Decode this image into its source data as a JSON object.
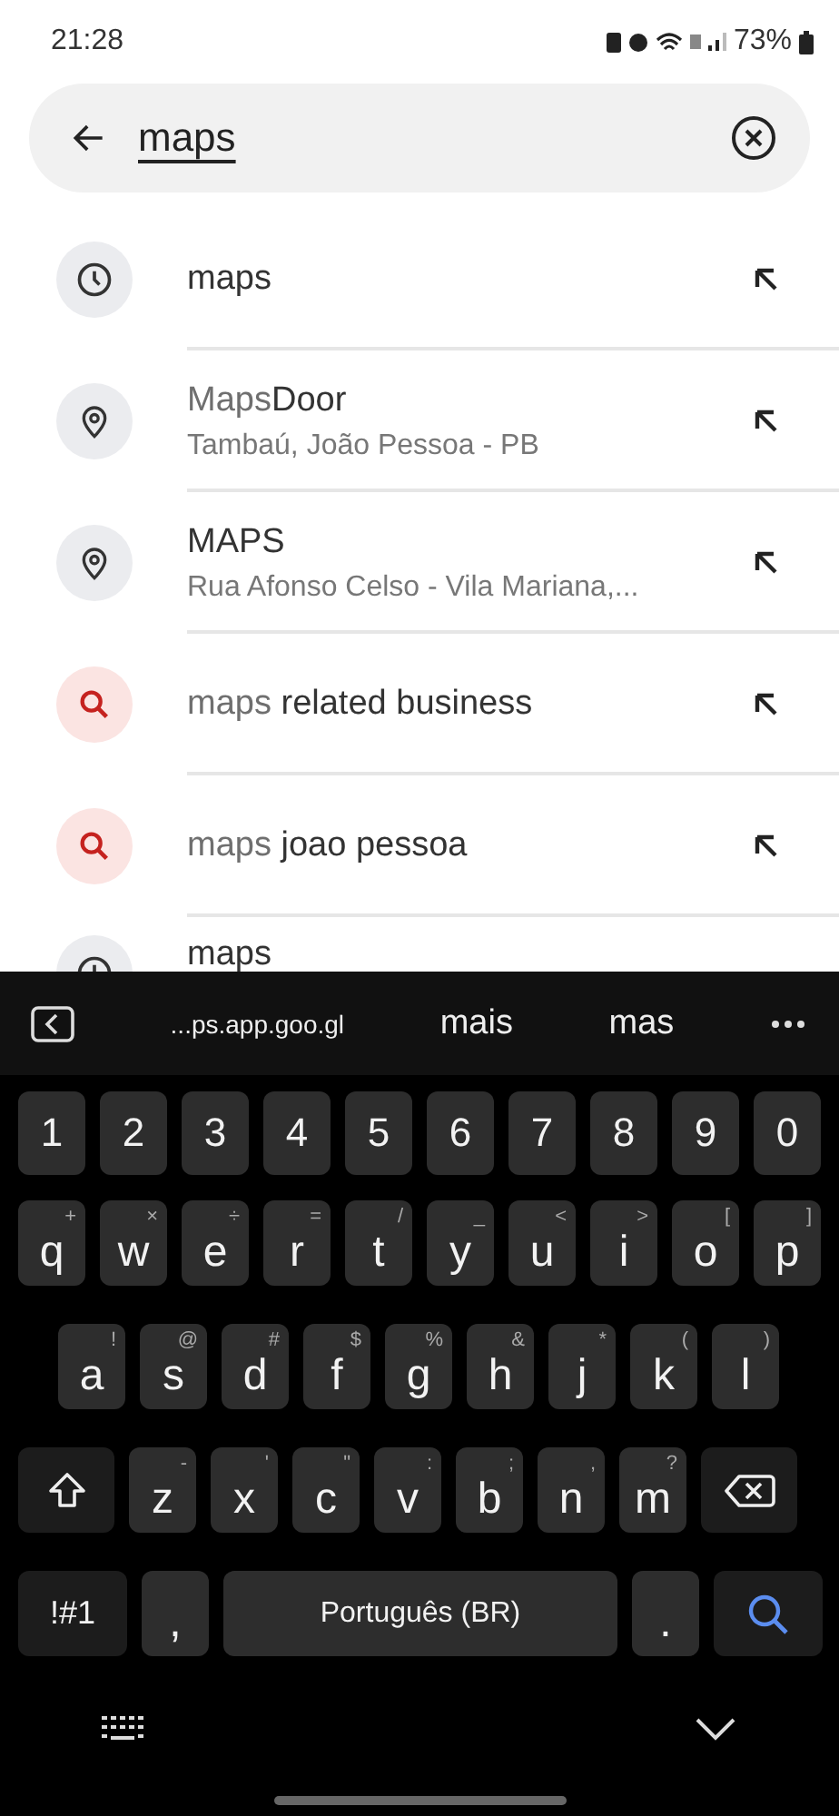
{
  "status_bar": {
    "time": "21:28",
    "battery": "73%"
  },
  "search": {
    "value": "maps"
  },
  "suggestions": [
    {
      "kind": "history",
      "title": "maps"
    },
    {
      "kind": "place",
      "title": "Maps**Door**",
      "subtitle": "Tambaú, João Pessoa - PB"
    },
    {
      "kind": "place",
      "title": "MAPS",
      "subtitle": "Rua Afonso Celso - Vila Mariana,..."
    },
    {
      "kind": "search",
      "title": "maps **related business**"
    },
    {
      "kind": "search",
      "title": "maps **joao pessoa**"
    },
    {
      "kind": "history",
      "title": "maps"
    }
  ],
  "keyboard": {
    "predictions": [
      "...ps.app.goo.gl",
      "mais",
      "mas"
    ],
    "key_rows": [
      [
        {
          "kind": "char",
          "label": "1"
        },
        {
          "kind": "char",
          "label": "2"
        },
        {
          "kind": "char",
          "label": "3"
        },
        {
          "kind": "char",
          "label": "4"
        },
        {
          "kind": "char",
          "label": "5"
        },
        {
          "kind": "char",
          "label": "6"
        },
        {
          "kind": "char",
          "label": "7"
        },
        {
          "kind": "char",
          "label": "8"
        },
        {
          "kind": "char",
          "label": "9"
        },
        {
          "kind": "char",
          "label": "0"
        }
      ],
      [
        {
          "kind": "char",
          "label": "q",
          "hint": "+"
        },
        {
          "kind": "char",
          "label": "w",
          "hint": "×"
        },
        {
          "kind": "char",
          "label": "e",
          "hint": "÷"
        },
        {
          "kind": "char",
          "label": "r",
          "hint": "="
        },
        {
          "kind": "char",
          "label": "t",
          "hint": "/"
        },
        {
          "kind": "char",
          "label": "y",
          "hint": "_"
        },
        {
          "kind": "char",
          "label": "u",
          "hint": "<"
        },
        {
          "kind": "char",
          "label": "i",
          "hint": ">"
        },
        {
          "kind": "char",
          "label": "o",
          "hint": "["
        },
        {
          "kind": "char",
          "label": "p",
          "hint": "]"
        }
      ],
      [
        {
          "kind": "char",
          "label": "a",
          "hint": "!"
        },
        {
          "kind": "char",
          "label": "s",
          "hint": "@"
        },
        {
          "kind": "char",
          "label": "d",
          "hint": "#"
        },
        {
          "kind": "char",
          "label": "f",
          "hint": "$"
        },
        {
          "kind": "char",
          "label": "g",
          "hint": "%"
        },
        {
          "kind": "char",
          "label": "h",
          "hint": "&"
        },
        {
          "kind": "char",
          "label": "j",
          "hint": "*"
        },
        {
          "kind": "char",
          "label": "k",
          "hint": "("
        },
        {
          "kind": "char",
          "label": "l",
          "hint": ")"
        }
      ],
      [
        {
          "kind": "shift"
        },
        {
          "kind": "char",
          "label": "z",
          "hint": "-"
        },
        {
          "kind": "char",
          "label": "x",
          "hint": "'"
        },
        {
          "kind": "char",
          "label": "c",
          "hint": "\""
        },
        {
          "kind": "char",
          "label": "v",
          "hint": ":"
        },
        {
          "kind": "char",
          "label": "b",
          "hint": ";"
        },
        {
          "kind": "char",
          "label": "n",
          "hint": ","
        },
        {
          "kind": "char",
          "label": "m",
          "hint": "?"
        },
        {
          "kind": "backspace"
        }
      ]
    ],
    "bottom_keys": [
      {
        "kind": "symbols",
        "label": "!#1"
      },
      {
        "kind": "char",
        "label": ","
      },
      {
        "kind": "space",
        "label": "Português (BR)"
      },
      {
        "kind": "char",
        "label": "."
      },
      {
        "kind": "search"
      }
    ]
  }
}
